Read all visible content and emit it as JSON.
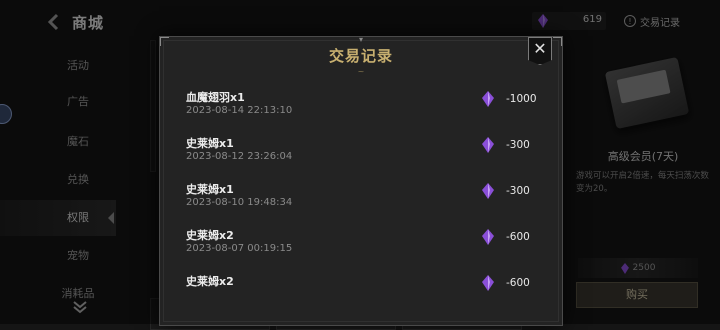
{
  "header": {
    "title": "商城",
    "currency_value": "619",
    "records_label": "交易记录"
  },
  "sidebar": {
    "items": [
      {
        "label": "活动"
      },
      {
        "label": "广告"
      },
      {
        "label": "魔石"
      },
      {
        "label": "兑换"
      },
      {
        "label": "权限"
      },
      {
        "label": "宠物"
      },
      {
        "label": "消耗品"
      }
    ],
    "active_index": 4
  },
  "product": {
    "name": "高级会员(7天)",
    "description": "游戏可以开启2倍速，每天扫荡次数变为20。",
    "price": "2500",
    "buy_label": "购买"
  },
  "modal": {
    "title": "交易记录",
    "records": [
      {
        "item": "血魔翅羽x1",
        "time": "2023-08-14 22:13:10",
        "amount": "-1000"
      },
      {
        "item": "史莱姆x1",
        "time": "2023-08-12 23:26:04",
        "amount": "-300"
      },
      {
        "item": "史莱姆x1",
        "time": "2023-08-10 19:48:34",
        "amount": "-300"
      },
      {
        "item": "史莱姆x2",
        "time": "2023-08-07 00:19:15",
        "amount": "-600"
      },
      {
        "item": "史莱姆x2",
        "time": "",
        "amount": "-600"
      }
    ]
  },
  "colors": {
    "gem": "#8a4fd8",
    "title_gold": "#c8b070"
  },
  "icons": {
    "back": "back-arrow-icon",
    "gem": "purple-crystal-icon",
    "info": "info-icon",
    "close": "close-icon",
    "scroll": "double-chevron-down-icon"
  }
}
